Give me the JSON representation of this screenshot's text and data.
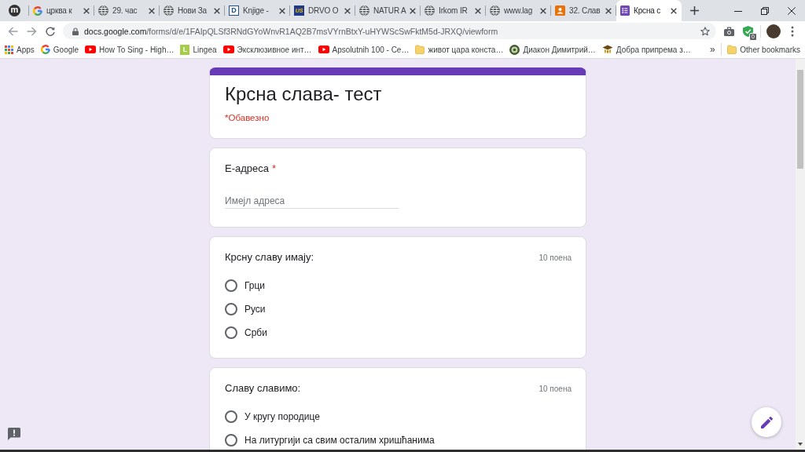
{
  "browser": {
    "tabs": [
      {
        "kind": "round",
        "logo_text": "m",
        "selected": false
      },
      {
        "kind": "google",
        "title": "црква к",
        "selected": false
      },
      {
        "kind": "globe",
        "title": "29. час",
        "selected": false
      },
      {
        "kind": "globe",
        "title": "Нови За",
        "selected": false
      },
      {
        "kind": "outlined",
        "logo_text": "D",
        "title": "Knjige -",
        "selected": false
      },
      {
        "kind": "navy",
        "logo_text": "US",
        "title": "DRVO O",
        "selected": false
      },
      {
        "kind": "globe",
        "title": "NATUR A",
        "selected": false
      },
      {
        "kind": "globe",
        "title": "Irkom IR",
        "selected": false
      },
      {
        "kind": "globe",
        "title": "www.lag",
        "selected": false
      },
      {
        "kind": "person",
        "title": "32. Слав",
        "selected": false
      },
      {
        "kind": "form",
        "title": "Крсна с",
        "selected": true
      }
    ],
    "toolbar": {
      "url_host": "docs.google.com",
      "url_path": "/forms/d/e/1FAIpQLSf3RNdGYoWnvR1AQ2B7msVYrnBtxY-uHYWScSwFktM5d-JRXQ/viewform",
      "extension_badge": "0"
    },
    "bookmarks": [
      {
        "kind": "apps",
        "label": "Apps"
      },
      {
        "kind": "google",
        "label": "Google"
      },
      {
        "kind": "youtube",
        "label": "How To Sing - High…"
      },
      {
        "kind": "lime",
        "logo_text": "L",
        "label": "Lingea"
      },
      {
        "kind": "youtube",
        "label": "Эксклюзивное инт…"
      },
      {
        "kind": "youtube",
        "label": "Apsolutnih 100 - Се…"
      },
      {
        "kind": "folder",
        "label": "живот цара конста…"
      },
      {
        "kind": "emblem",
        "label": "Диакон Димитрий…"
      },
      {
        "kind": "cap",
        "label": "Добра припрема з…"
      }
    ],
    "bookmarks_more": "»",
    "other_bookmarks": {
      "kind": "folder",
      "label": "Other bookmarks"
    }
  },
  "form": {
    "title": "Крсна слава- тест",
    "required_note": "*Обавезно",
    "questions": [
      {
        "kind": "text",
        "label": "Е-адреса",
        "required_mark": "*",
        "placeholder": "Имејл адреса"
      },
      {
        "kind": "choice",
        "label": "Крсну славу имају:",
        "points": "10 поена",
        "options": [
          {
            "label": "Грци",
            "selected": false
          },
          {
            "label": "Руси",
            "selected": false
          },
          {
            "label": "Срби",
            "selected": false
          }
        ]
      },
      {
        "kind": "choice",
        "label": "Славу славимо:",
        "points": "10 поена",
        "options": [
          {
            "label": "У кругу породице",
            "selected": false
          },
          {
            "label": "На литургији са свим осталим хришћанима",
            "selected": false
          }
        ]
      }
    ]
  }
}
